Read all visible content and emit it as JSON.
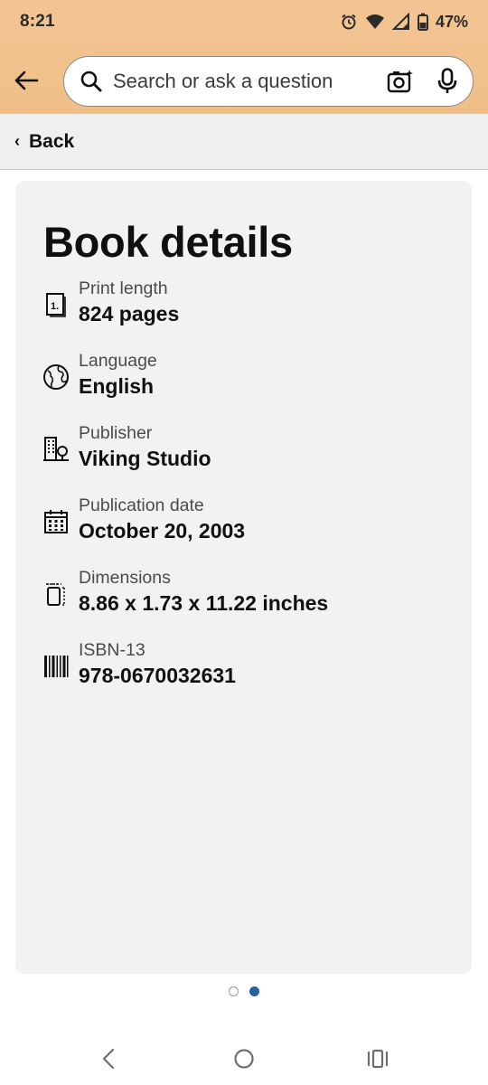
{
  "status_bar": {
    "time": "8:21",
    "battery": "47%"
  },
  "search": {
    "placeholder": "Search or ask a question"
  },
  "back_bar": {
    "label": "Back"
  },
  "card": {
    "title": "Book details",
    "details": [
      {
        "label": "Print length",
        "value": "824 pages",
        "icon": "page-count-icon"
      },
      {
        "label": "Language",
        "value": "English",
        "icon": "globe-icon"
      },
      {
        "label": "Publisher",
        "value": "Viking Studio",
        "icon": "building-icon"
      },
      {
        "label": "Publication date",
        "value": "October 20, 2003",
        "icon": "calendar-icon"
      },
      {
        "label": "Dimensions",
        "value": "8.86 x 1.73 x 11.22 inches",
        "icon": "dimensions-icon"
      },
      {
        "label": "ISBN-13",
        "value": "978-0670032631",
        "icon": "barcode-icon"
      }
    ]
  },
  "pager": {
    "total": 2,
    "active_index": 1
  },
  "colors": {
    "header_band": "#f3c593",
    "back_bar_bg": "#eef0f0",
    "card_bg": "#f1f2f4",
    "pager_active": "#2162a1"
  }
}
